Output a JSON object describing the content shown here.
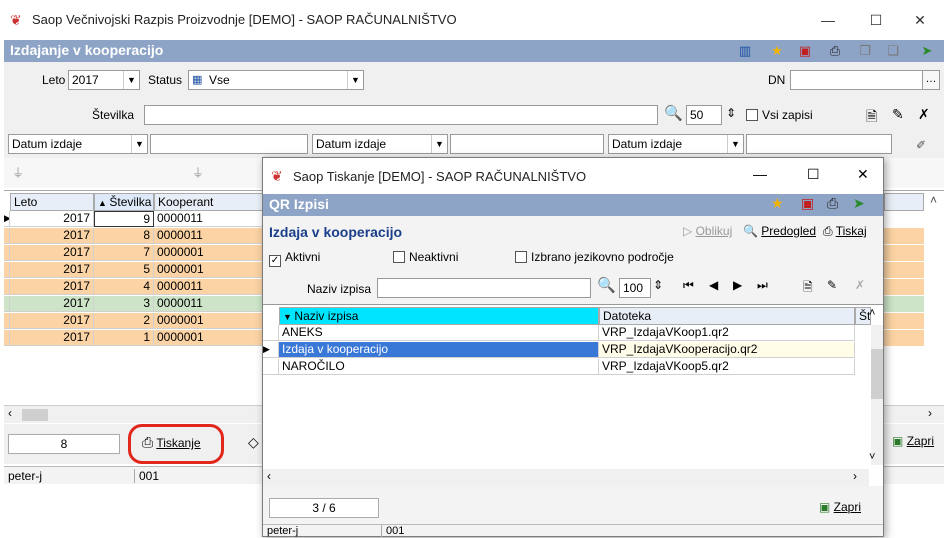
{
  "main_window": {
    "title": "Saop   Večnivojski Razpis Proizvodnje [DEMO] - SAOP RAČUNALNIŠTVO",
    "controls": {
      "minimize": "—",
      "maximize": "☐",
      "close": "✕"
    }
  },
  "module": {
    "title": "Izdajanje v kooperacijo"
  },
  "filter": {
    "leto_label": "Leto",
    "leto_value": "2017",
    "status_label": "Status",
    "status_value": "Vse",
    "dn_label": "DN",
    "dn_value": "",
    "stevilka_label": "Številka",
    "stevilka_value": "",
    "count_value": "50",
    "vsi_zapisi": "Vsi zapisi",
    "date_filters": [
      "Datum izdaje",
      "Datum izdaje",
      "Datum izdaje"
    ]
  },
  "grid": {
    "columns": [
      "Leto",
      "Številka",
      "Kooperant"
    ],
    "rows": [
      {
        "leto": "2017",
        "stevilka": "9",
        "kooperant": "0000011",
        "style": "sel"
      },
      {
        "leto": "2017",
        "stevilka": "8",
        "kooperant": "0000011",
        "style": "orange"
      },
      {
        "leto": "2017",
        "stevilka": "7",
        "kooperant": "0000001",
        "style": "orange"
      },
      {
        "leto": "2017",
        "stevilka": "5",
        "kooperant": "0000001",
        "style": "orange"
      },
      {
        "leto": "2017",
        "stevilka": "4",
        "kooperant": "0000011",
        "style": "orange"
      },
      {
        "leto": "2017",
        "stevilka": "3",
        "kooperant": "0000011",
        "style": "green"
      },
      {
        "leto": "2017",
        "stevilka": "2",
        "kooperant": "0000001",
        "style": "orange"
      },
      {
        "leto": "2017",
        "stevilka": "1",
        "kooperant": "0000001",
        "style": "orange"
      }
    ]
  },
  "bottom": {
    "count": "8",
    "tiskanje": "Tiskanje",
    "zapri": "Zapri",
    "user": "peter-j",
    "code": "001"
  },
  "dialog": {
    "title": "Saop Tiskanje [DEMO] - SAOP RAČUNALNIŠTVO",
    "header": "QR Izpisi",
    "subtitle": "Izdaja v kooperacijo",
    "oblikuj": "Oblikuj",
    "predogled": "Predogled",
    "tiskaj": "Tiskaj",
    "aktivni": "Aktivni",
    "neaktivni": "Neaktivni",
    "izbrano": "Izbrano jezikovno področje",
    "naziv_label": "Naziv izpisa",
    "naziv_value": "",
    "count_value": "100",
    "columns": [
      "Naziv izpisa",
      "Datoteka",
      "Št"
    ],
    "rows": [
      {
        "naziv": "ANEKS",
        "datoteka": "VRP_IzdajaVKoop1.qr2",
        "style": "normal"
      },
      {
        "naziv": "Izdaja v kooperacijo",
        "datoteka": "VRP_IzdajaVKooperacijo.qr2",
        "style": "selected"
      },
      {
        "naziv": "NAROČILO",
        "datoteka": "VRP_IzdajaVKoop5.qr2",
        "style": "normal"
      }
    ],
    "pager": "3 / 6",
    "zapri": "Zapri",
    "user": "peter-j",
    "code": "001"
  },
  "colors": {
    "header_bg": "#8ea4c6",
    "row_orange": "#fbd3a4",
    "row_green": "#cde4c8",
    "selected_blue": "#3a78d8",
    "circle_red": "#e1261c"
  }
}
